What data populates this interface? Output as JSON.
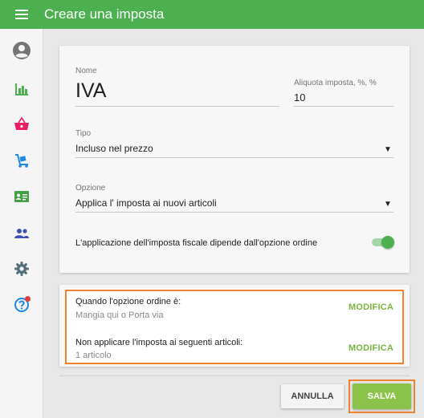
{
  "appbar": {
    "title": "Creare una imposta",
    "color": "#4caf50"
  },
  "sidebar": {
    "items": [
      {
        "name": "account",
        "icon": "account-circle-icon",
        "color": "#757575"
      },
      {
        "name": "reports",
        "icon": "bar-chart-icon",
        "color": "#4caf50"
      },
      {
        "name": "sales",
        "icon": "basket-icon",
        "color": "#e91e63"
      },
      {
        "name": "inventory",
        "icon": "dolly-icon",
        "color": "#1e88e5"
      },
      {
        "name": "customers",
        "icon": "contact-card-icon",
        "color": "#43a047"
      },
      {
        "name": "employees",
        "icon": "people-icon",
        "color": "#3f51b5"
      },
      {
        "name": "settings",
        "icon": "gear-icon",
        "color": "#546e7a"
      },
      {
        "name": "help",
        "icon": "help-icon",
        "color": "#1e88e5",
        "badge_color": "#e53935"
      }
    ]
  },
  "form": {
    "name_label": "Nome",
    "name_value": "IVA",
    "rate_label": "Aliquota imposta, %, %",
    "rate_value": "10",
    "type_label": "Tipo",
    "type_value": "Incluso nel prezzo",
    "option_label": "Opzione",
    "option_value": "Applica l' imposta ai nuovi articoli",
    "toggle_label": "L'applicazione dell'imposta fiscale dipende dall'opzione ordine",
    "toggle_on": true
  },
  "options": {
    "rows": [
      {
        "title": "Quando l'opzione ordine è:",
        "subtitle": "Mangia qui o Porta via",
        "action": "MODIFICA"
      },
      {
        "title": "Non applicare l'imposta ai seguenti articoli:",
        "subtitle": "1 articolo",
        "action": "MODIFICA"
      }
    ],
    "highlight_color": "#f0822e"
  },
  "actions": {
    "cancel": "ANNULLA",
    "save": "SALVA"
  }
}
